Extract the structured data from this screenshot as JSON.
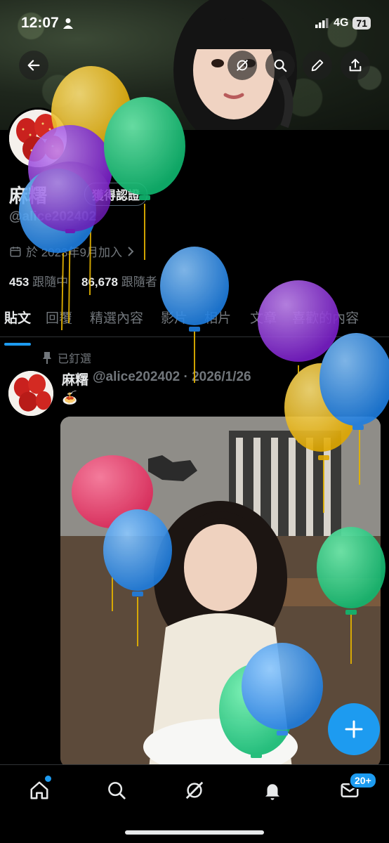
{
  "status_bar": {
    "time": "12:07",
    "network": "4G",
    "battery": "71"
  },
  "profile": {
    "name": "麻糬",
    "verify_label": "獲得認證",
    "handle": "@alice202402",
    "joined": "於 2023年9月加入",
    "following_count": "453",
    "following_label": "跟隨中",
    "followers_count": "86,678",
    "followers_label": "跟隨者"
  },
  "tabs": [
    "貼文",
    "回覆",
    "精選內容",
    "影片",
    "相片",
    "文章",
    "喜歡的內容"
  ],
  "post": {
    "pinned_label": "已釘選",
    "author": "麻糬",
    "meta": "@alice202402 · 2026/1/26",
    "emoji": "🍝"
  },
  "nav": {
    "messages_badge": "20+"
  },
  "colors": {
    "accent": "#1d9bf0",
    "background": "#000000",
    "muted": "#71767b"
  },
  "icons": [
    "back-icon",
    "grok-icon",
    "search-icon",
    "edit-icon",
    "share-icon",
    "calendar-icon",
    "pin-icon",
    "plus-icon",
    "home-icon",
    "notifications-icon",
    "messages-icon"
  ]
}
